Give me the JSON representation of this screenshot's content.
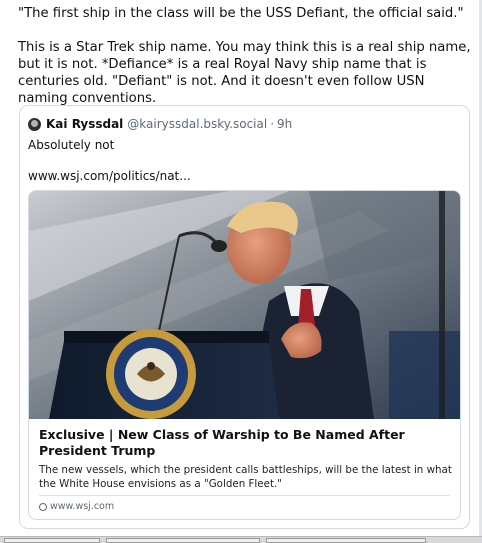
{
  "post": {
    "paragraphs": [
      "\"The first ship in the class will be the USS Defiant, the official said.\"",
      "This is a Star Trek ship name. You may think this is a real ship name, but it is not. *Defiance* is a real Royal Navy ship name that is centuries old. \"Defiant\" is not. And it doesn't even follow USN naming conventions."
    ]
  },
  "quote": {
    "author_name": "Kai Ryssdal",
    "author_handle": "@kairyssdal.bsky.social",
    "separator": "·",
    "time": "9h",
    "body": "Absolutely not",
    "link_text": "www.wsj.com/politics/nat..."
  },
  "embed": {
    "title": "Exclusive | New Class of Warship to Be Named After President Trump",
    "description": "The new vessels, which the president calls battleships, will be the latest in what the White House envisions as a \"Golden Fleet.\"",
    "domain": "www.wsj.com"
  },
  "colors": {
    "text": "#111111",
    "muted": "#5e6b78",
    "border": "#d4dae1"
  }
}
